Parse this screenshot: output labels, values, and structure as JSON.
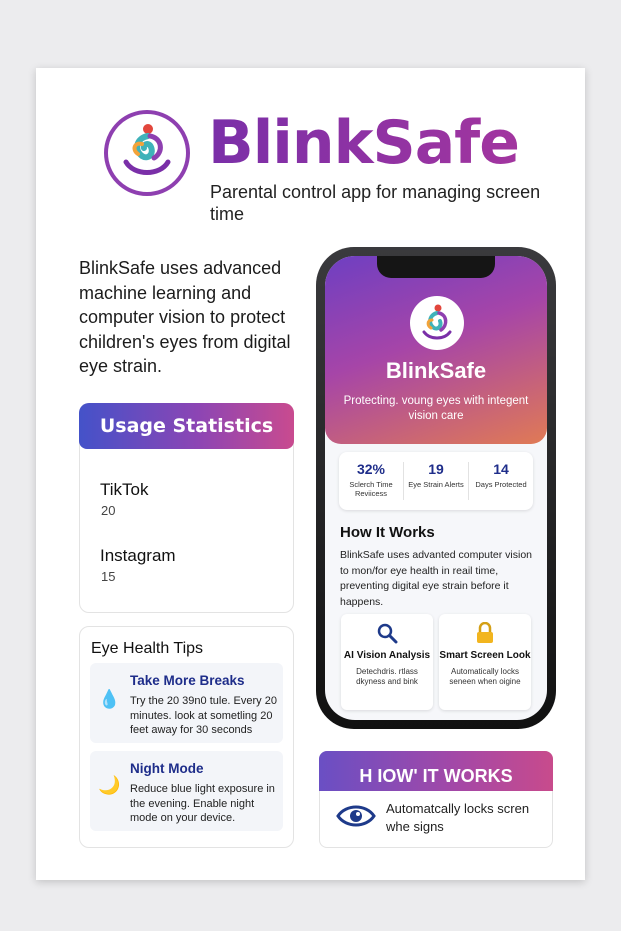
{
  "header": {
    "title": "BlinkSafe",
    "subtitle": "Parental control app for managing screen time"
  },
  "intro": "BlinkSafe uses advanced machine learning and computer vision to protect children's eyes from digital eye strain.",
  "usage": {
    "title": "Usage Statistics",
    "apps": [
      {
        "name": "TikTok",
        "value": "20"
      },
      {
        "name": "Instagram",
        "value": "15"
      }
    ]
  },
  "tips": {
    "title": "Eye Health Tips",
    "items": [
      {
        "icon": "water-drop-icon",
        "title": "Take More Breaks",
        "text": "Try the 20 39n0 tule. Every 20 minutes. look at sometling 20 feet away for 30 seconds"
      },
      {
        "icon": "moon-icon",
        "title": "Night Mode",
        "text": "Reduce blue light exposure in the evening. Enable night mode on your device."
      }
    ]
  },
  "phone": {
    "title": "BlinkSafe",
    "subtitle": "Protecting. voung eyes with integent vision care",
    "stats": [
      {
        "value": "32%",
        "label": "Sclerch Time Reviicess"
      },
      {
        "value": "19",
        "label": "Eye Strain Alerts"
      },
      {
        "value": "14",
        "label": "Days Protected"
      }
    ],
    "how_title": "How It Works",
    "how_text": "BlinkSafe uses advanted computer vision to mon/for eye health in reail time, preventing digital eye strain before it happens.",
    "features": [
      {
        "icon": "magnifier-icon",
        "title": "AI Vision Analysis",
        "text": "Detechdris. rtlass dkyness and bink"
      },
      {
        "icon": "lock-icon",
        "title": "Smart Screen Look",
        "text": "Automatically locks seneen when oigine"
      }
    ]
  },
  "how_card": {
    "title": "H IOW' IT WORKS",
    "icon": "eye-icon",
    "text": "Automatcally locks scren whe signs"
  },
  "colors": {
    "brand_purple": "#8e3fb0",
    "accent_blue": "#1e2d8a",
    "gradient_start": "#4452c9",
    "gradient_end": "#c94b8f"
  }
}
